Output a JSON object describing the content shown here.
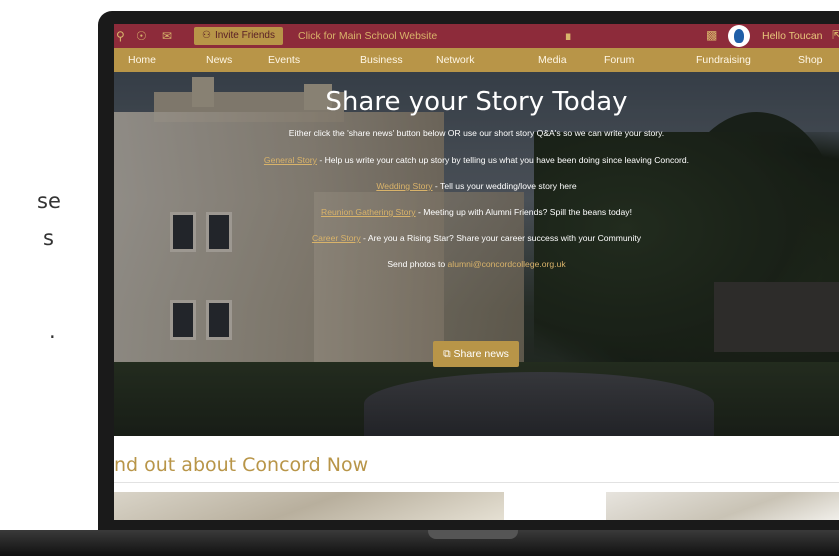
{
  "left_copy": {
    "line1": "se",
    "line2": "s",
    "line3": "."
  },
  "topbar": {
    "invite_label": "Invite Friends",
    "main_school_link": "Click for Main School Website",
    "greeting": "Hello Toucan"
  },
  "nav": {
    "items": [
      "Home",
      "News",
      "Events",
      "Business",
      "Network",
      "Media",
      "Forum",
      "Fundraising",
      "Shop"
    ]
  },
  "hero": {
    "title": "Share your Story Today",
    "intro": "Either click the 'share news' button below OR use our short story Q&A's so we can write your story.",
    "stories": [
      {
        "link": "General Story",
        "text": " - Help us write your catch up story by telling us what you have been doing since leaving Concord."
      },
      {
        "link": "Wedding Story",
        "text": " - Tell us your wedding/love story here"
      },
      {
        "link": "Reunion Gathering Story",
        "text": " - Meeting up with Alumni Friends? Spill the beans today!"
      },
      {
        "link": "Career Story",
        "text": " - Are you a Rising Star? Share your career success with your Community"
      }
    ],
    "photos_prefix": "Send photos to ",
    "photos_email": "alumni@concordcollege.org.uk",
    "share_button": "Share news"
  },
  "section": {
    "title": "nd out about Concord Now"
  },
  "icons": {
    "search": "search-icon",
    "bell": "bell-icon",
    "mail": "mail-icon",
    "people": "people-icon",
    "bank": "bank-icon",
    "stats": "stats-icon",
    "logout": "logout-icon",
    "share": "share-icon"
  },
  "colors": {
    "maroon": "#8d2b3a",
    "gold": "#b89548",
    "link_gold": "#d9b36a"
  }
}
